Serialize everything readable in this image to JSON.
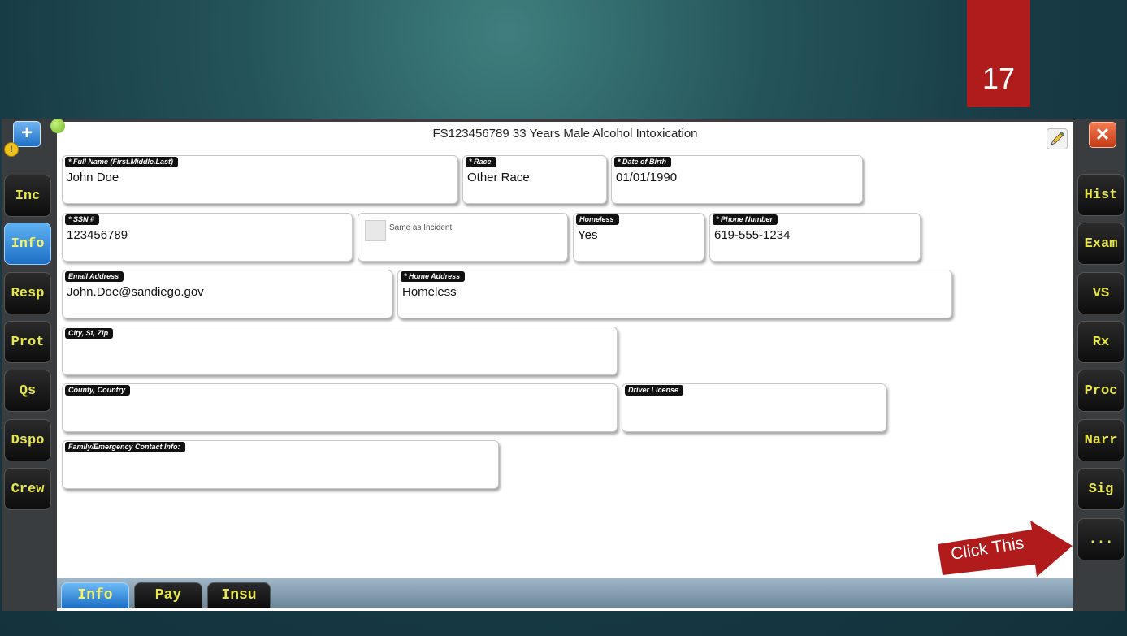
{
  "slide": {
    "number": "17"
  },
  "header": {
    "title": "FS123456789 33 Years Male Alcohol Intoxication",
    "warning_count": "!"
  },
  "left_nav": [
    {
      "label": "Inc",
      "active": false
    },
    {
      "label": "Info",
      "active": true
    },
    {
      "label": "Resp",
      "active": false
    },
    {
      "label": "Prot",
      "active": false
    },
    {
      "label": "Qs",
      "active": false
    },
    {
      "label": "Dspo",
      "active": false
    },
    {
      "label": "Crew",
      "active": false
    }
  ],
  "right_nav": [
    {
      "label": "Hist"
    },
    {
      "label": "Exam"
    },
    {
      "label": "VS"
    },
    {
      "label": "Rx"
    },
    {
      "label": "Proc"
    },
    {
      "label": "Narr"
    },
    {
      "label": "Sig"
    },
    {
      "label": "..."
    }
  ],
  "form": {
    "full_name": {
      "label": "* Full Name (First.Middle.Last)",
      "value": "John  Doe"
    },
    "race": {
      "label": "* Race",
      "value": "Other Race"
    },
    "dob": {
      "label": "* Date of Birth",
      "value": "01/01/1990"
    },
    "ssn": {
      "label": "* SSN #",
      "value": "123456789"
    },
    "same_as_incident": {
      "label": "Same as Incident",
      "checked": false
    },
    "homeless": {
      "label": "Homeless",
      "value": "Yes"
    },
    "phone": {
      "label": "* Phone Number",
      "value": "619-555-1234"
    },
    "email": {
      "label": "Email Address",
      "value": "John.Doe@sandiego.gov"
    },
    "home_address": {
      "label": "* Home Address",
      "value": "Homeless"
    },
    "city_st_zip": {
      "label": "City, St, Zip",
      "value": ""
    },
    "county_country": {
      "label": "County, Country",
      "value": ""
    },
    "driver_license": {
      "label": "Driver License",
      "value": ""
    },
    "emergency_contact": {
      "label": "Family/Emergency Contact Info:",
      "value": ""
    }
  },
  "bottom_tabs": [
    {
      "label": "Info",
      "active": true
    },
    {
      "label": "Pay",
      "active": false
    },
    {
      "label": "Insu",
      "active": false
    }
  ],
  "callout": {
    "text": "Click This"
  },
  "colors": {
    "nav_text": "#e8e84a",
    "active_blue": "#1d6fc6",
    "slide_badge": "#b01c1c",
    "callout_red": "#b21b1b"
  }
}
